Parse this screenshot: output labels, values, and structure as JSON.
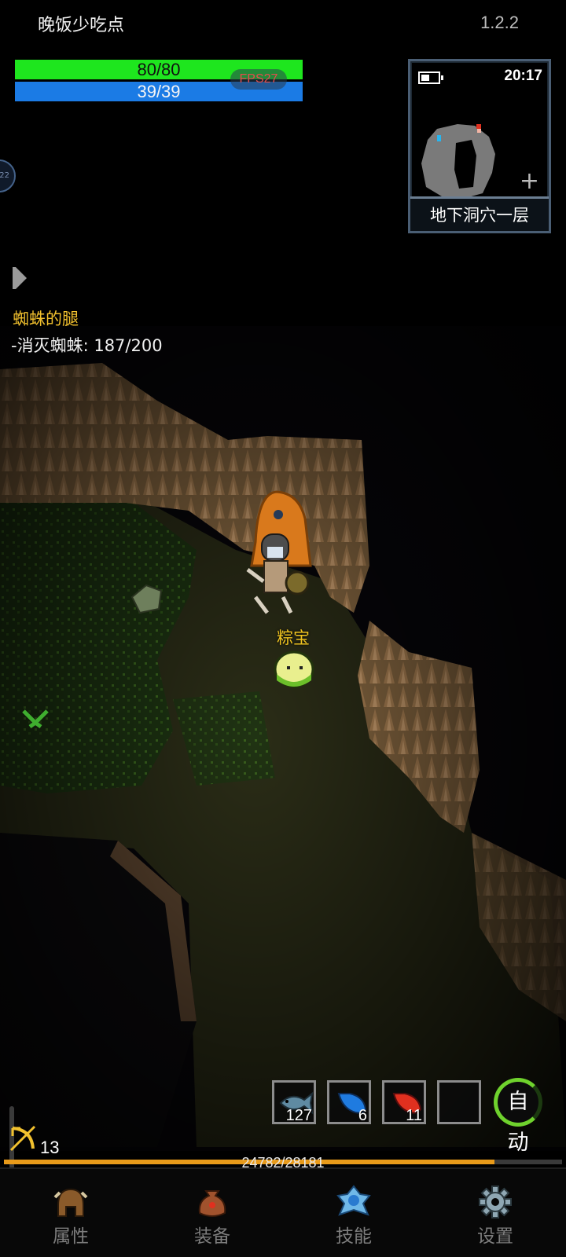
{
  "header": {
    "player_name": "晚饭少吃点",
    "version": "1.2.2"
  },
  "stats": {
    "hp": {
      "current": 80,
      "max": 80,
      "text": "80/80",
      "fraction": 1.0
    },
    "mp": {
      "current": 39,
      "max": 39,
      "text": "39/39",
      "fraction": 1.0
    },
    "fps_text": "FPS27",
    "side_bubble_text": "22"
  },
  "minimap": {
    "time": "20:17",
    "zoom_label": "+",
    "level_name": "地下洞穴一层"
  },
  "quest": {
    "title": "蜘蛛的腿",
    "progress_text": "-消灭蜘蛛: 187/200",
    "current": 187,
    "target": 200
  },
  "entities": {
    "pet_name": "粽宝"
  },
  "quickbar": {
    "slots": [
      {
        "icon": "fish-icon",
        "count": "127",
        "color": "#5f8aa2"
      },
      {
        "icon": "blue-potion-icon",
        "count": "6",
        "color": "#1f7be0"
      },
      {
        "icon": "red-potion-icon",
        "count": "11",
        "color": "#e0301f"
      },
      {
        "icon": "empty-slot",
        "count": ""
      }
    ],
    "auto_label": "自动"
  },
  "player_level": {
    "level": "13",
    "xp_text": "24782/28181",
    "xp_current": 24782,
    "xp_max": 28181
  },
  "nav": {
    "items": [
      {
        "label": "属性",
        "icon": "helmet-icon"
      },
      {
        "label": "装备",
        "icon": "bag-icon"
      },
      {
        "label": "技能",
        "icon": "skill-gem-icon"
      },
      {
        "label": "设置",
        "icon": "gear-icon"
      }
    ]
  },
  "colors": {
    "hp": "#1ee61e",
    "mp": "#1b7be5",
    "quest_title": "#f2c12e",
    "pet_label": "#f0c420",
    "xp": "#e89a1a",
    "auto_ring": "#6fd22d"
  }
}
